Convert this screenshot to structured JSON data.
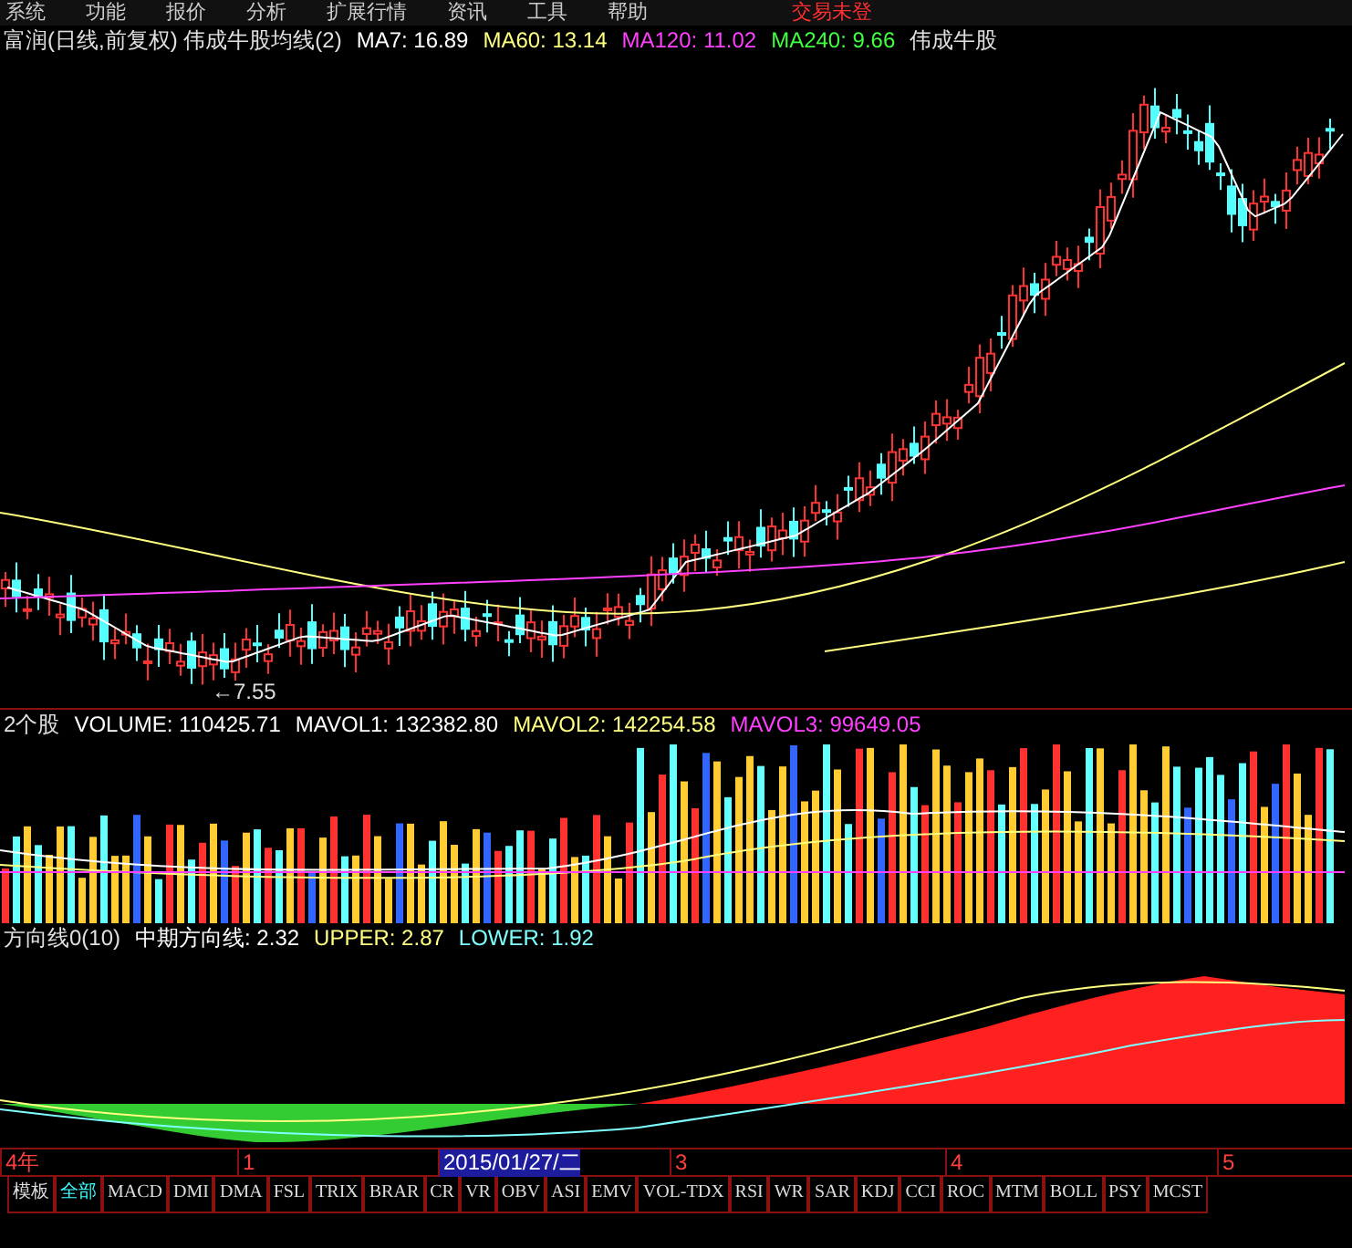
{
  "menu": [
    "系统",
    "功能",
    "报价",
    "分析",
    "扩展行情",
    "资讯",
    "工具",
    "帮助"
  ],
  "login_status": "交易未登",
  "price_header": [
    {
      "text": "富润(日线,前复权) 伟成牛股均线(2)",
      "color": "#e0e0e0"
    },
    {
      "text": "MA7: 16.89",
      "color": "#ffffff"
    },
    {
      "text": "MA60: 13.14",
      "color": "#ffff80"
    },
    {
      "text": "MA120: 11.02",
      "color": "#ff40ff"
    },
    {
      "text": "MA240: 9.66",
      "color": "#40ff40"
    },
    {
      "text": "伟成牛股",
      "color": "#e0e0e0"
    }
  ],
  "low_price_label": "←7.55",
  "volume_header": [
    {
      "text": "2个股",
      "color": "#e0e0e0"
    },
    {
      "text": "VOLUME: 110425.71",
      "color": "#ffffff"
    },
    {
      "text": "MAVOL1: 132382.80",
      "color": "#ffffff"
    },
    {
      "text": "MAVOL2: 142254.58",
      "color": "#ffff80"
    },
    {
      "text": "MAVOL3: 99649.05",
      "color": "#ff40ff"
    }
  ],
  "indicator_header": [
    {
      "text": "方向线0(10)",
      "color": "#e0e0e0"
    },
    {
      "text": "中期方向线: 2.32",
      "color": "#ffffff"
    },
    {
      "text": "UPPER: 2.87",
      "color": "#ffff80"
    },
    {
      "text": "LOWER: 1.92",
      "color": "#80ffff"
    }
  ],
  "time_axis": [
    {
      "label": "4年",
      "highlighted": false
    },
    {
      "label": "1",
      "highlighted": false
    },
    {
      "label": "2015/01/27/二",
      "highlighted": true
    },
    {
      "label": "3",
      "highlighted": false
    },
    {
      "label": "4",
      "highlighted": false
    },
    {
      "label": "5",
      "highlighted": false
    }
  ],
  "indicator_tabs": [
    {
      "label": "模板",
      "selected": false
    },
    {
      "label": "全部",
      "selected": true
    },
    {
      "label": "MACD",
      "selected": false
    },
    {
      "label": "DMI",
      "selected": false
    },
    {
      "label": "DMA",
      "selected": false
    },
    {
      "label": "FSL",
      "selected": false
    },
    {
      "label": "TRIX",
      "selected": false
    },
    {
      "label": "BRAR",
      "selected": false
    },
    {
      "label": "CR",
      "selected": false
    },
    {
      "label": "VR",
      "selected": false
    },
    {
      "label": "OBV",
      "selected": false
    },
    {
      "label": "ASI",
      "selected": false
    },
    {
      "label": "EMV",
      "selected": false
    },
    {
      "label": "VOL-TDX",
      "selected": false
    },
    {
      "label": "RSI",
      "selected": false
    },
    {
      "label": "WR",
      "selected": false
    },
    {
      "label": "SAR",
      "selected": false
    },
    {
      "label": "KDJ",
      "selected": false
    },
    {
      "label": "CCI",
      "selected": false
    },
    {
      "label": "ROC",
      "selected": false
    },
    {
      "label": "MTM",
      "selected": false
    },
    {
      "label": "BOLL",
      "selected": false
    },
    {
      "label": "PSY",
      "selected": false
    },
    {
      "label": "MCST",
      "selected": false
    }
  ]
}
